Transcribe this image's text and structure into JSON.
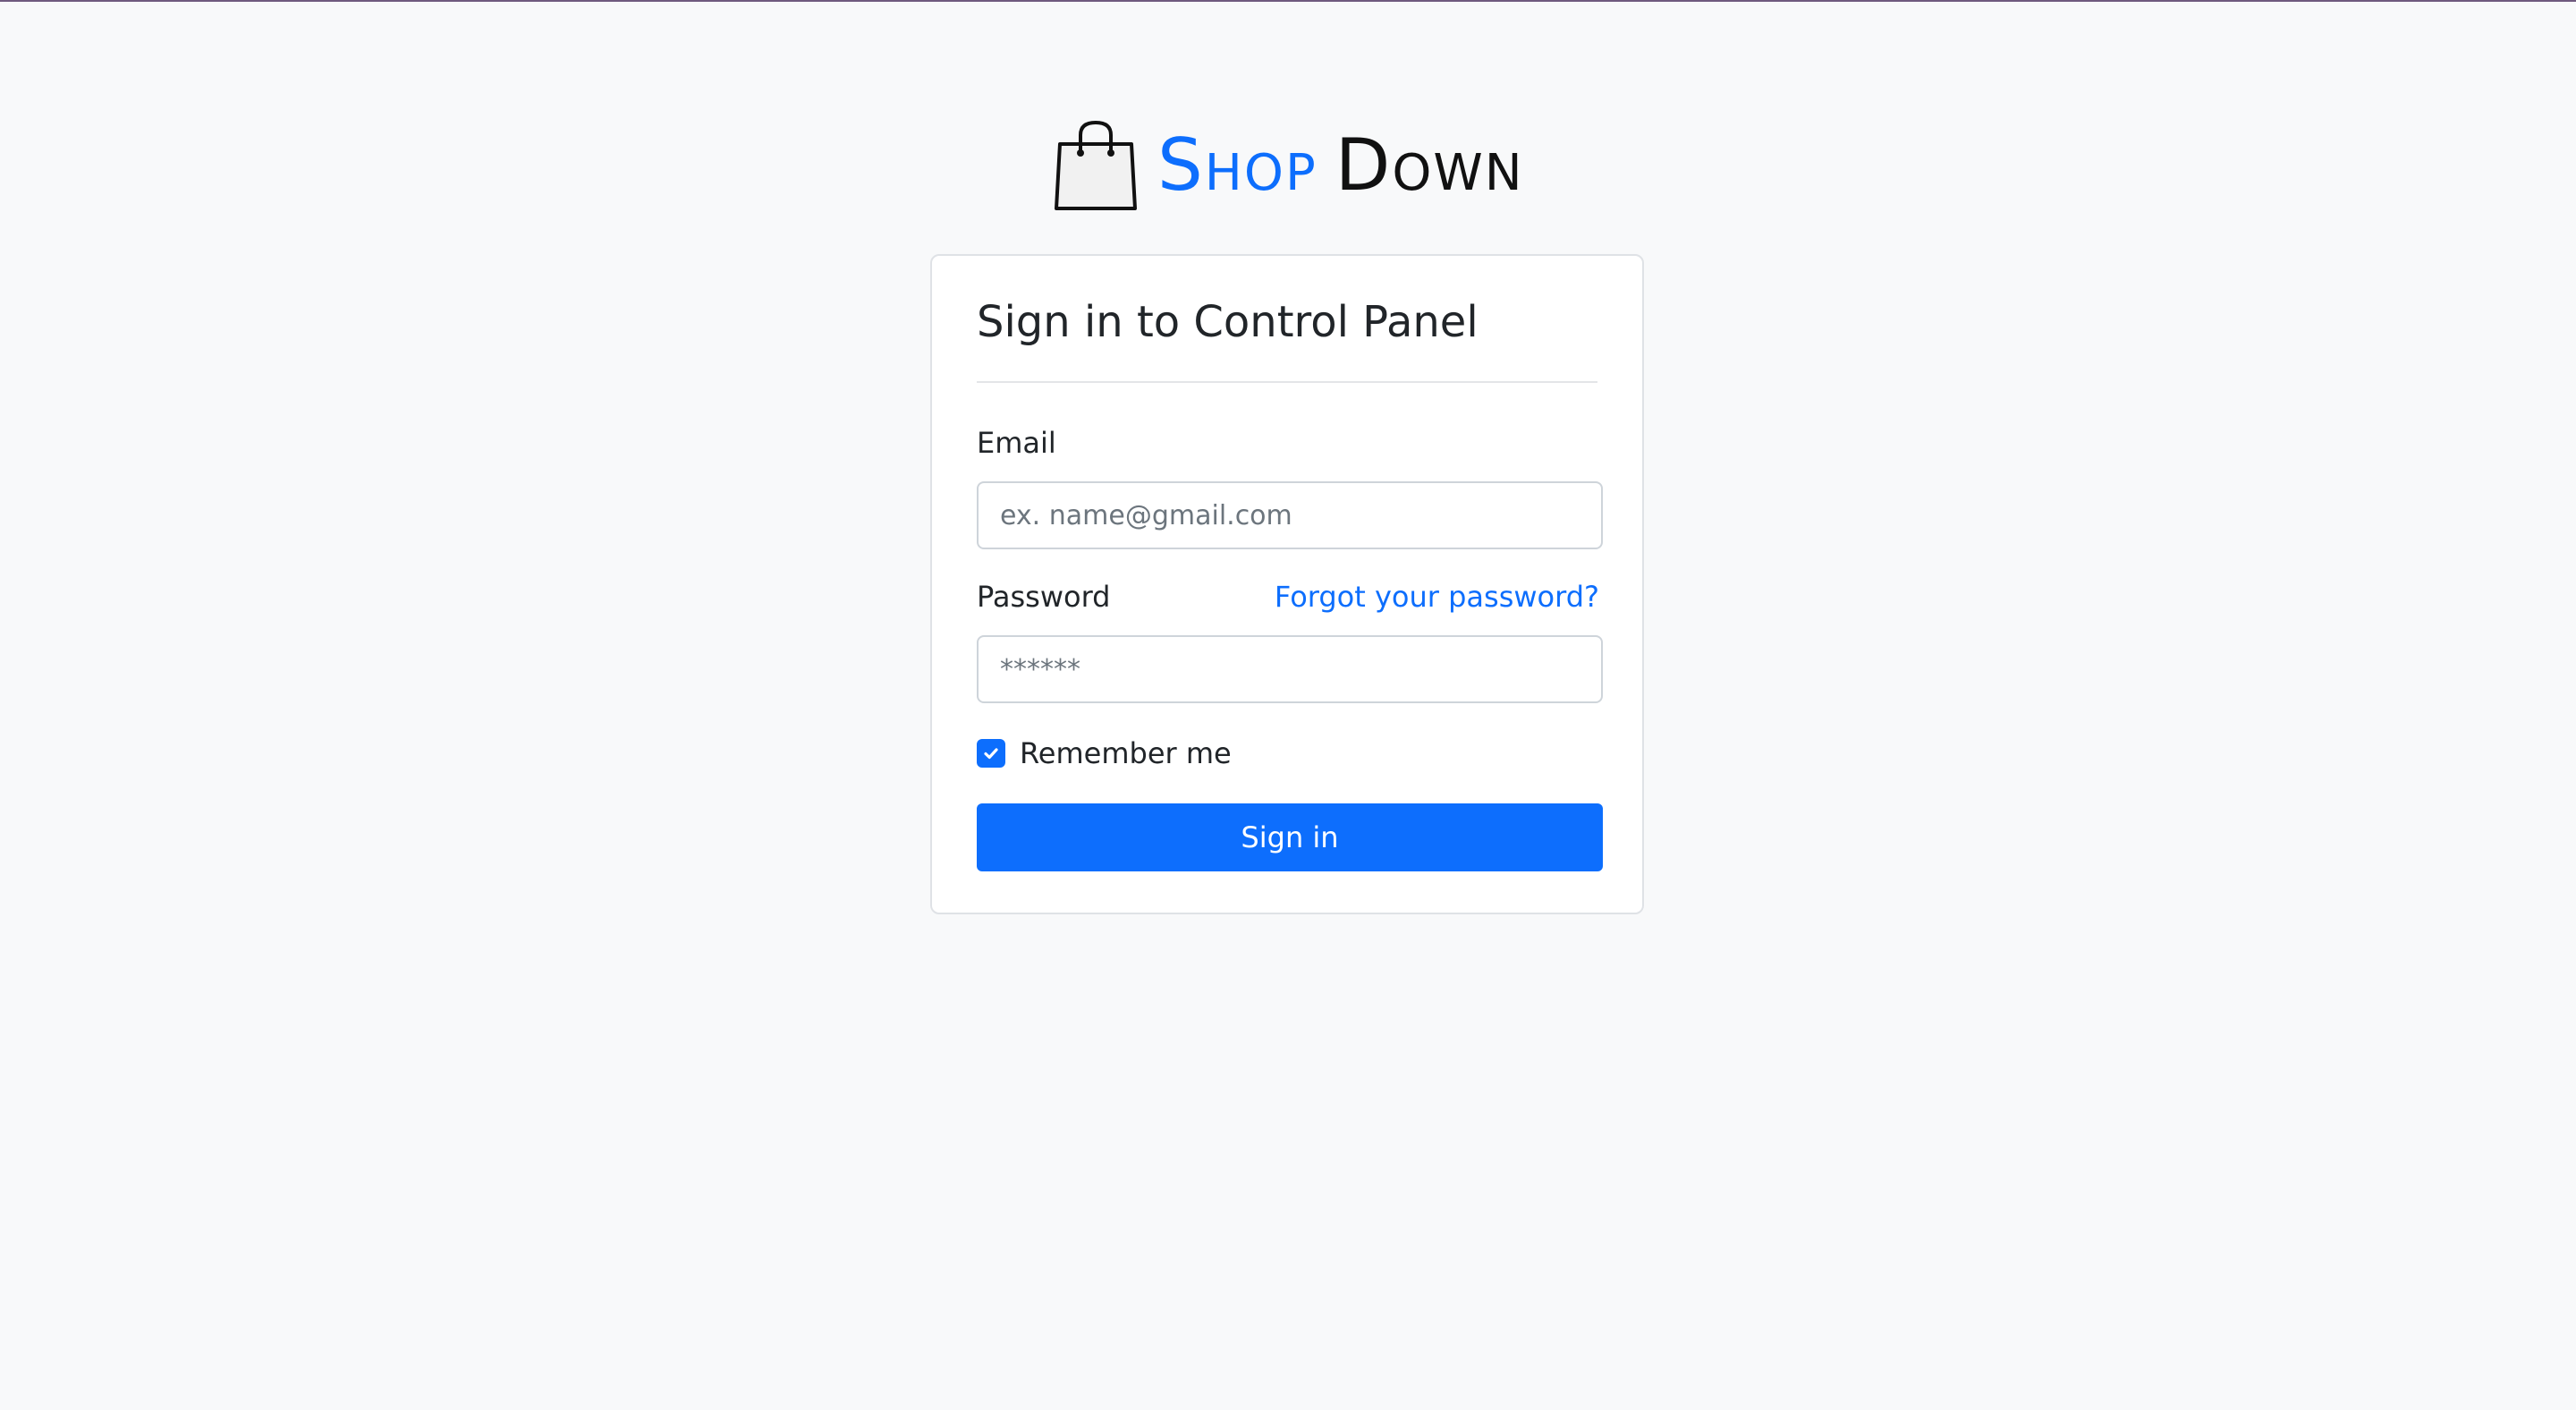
{
  "brand": {
    "name_part1": "Shop",
    "name_part2": "Down",
    "icon": "shopping-bag-icon"
  },
  "form": {
    "title": "Sign in to Control Panel",
    "email_label": "Email",
    "email_placeholder": "ex. name@gmail.com",
    "email_value": "",
    "password_label": "Password",
    "forgot_link": "Forgot your password?",
    "password_placeholder": "******",
    "password_value": "",
    "remember_label": "Remember me",
    "remember_checked": true,
    "checkbox_icon": "check-icon",
    "submit_label": "Sign in"
  },
  "colors": {
    "accent": "#0d6efd",
    "background": "#f8f9fa",
    "card": "#ffffff",
    "text": "#212529"
  }
}
